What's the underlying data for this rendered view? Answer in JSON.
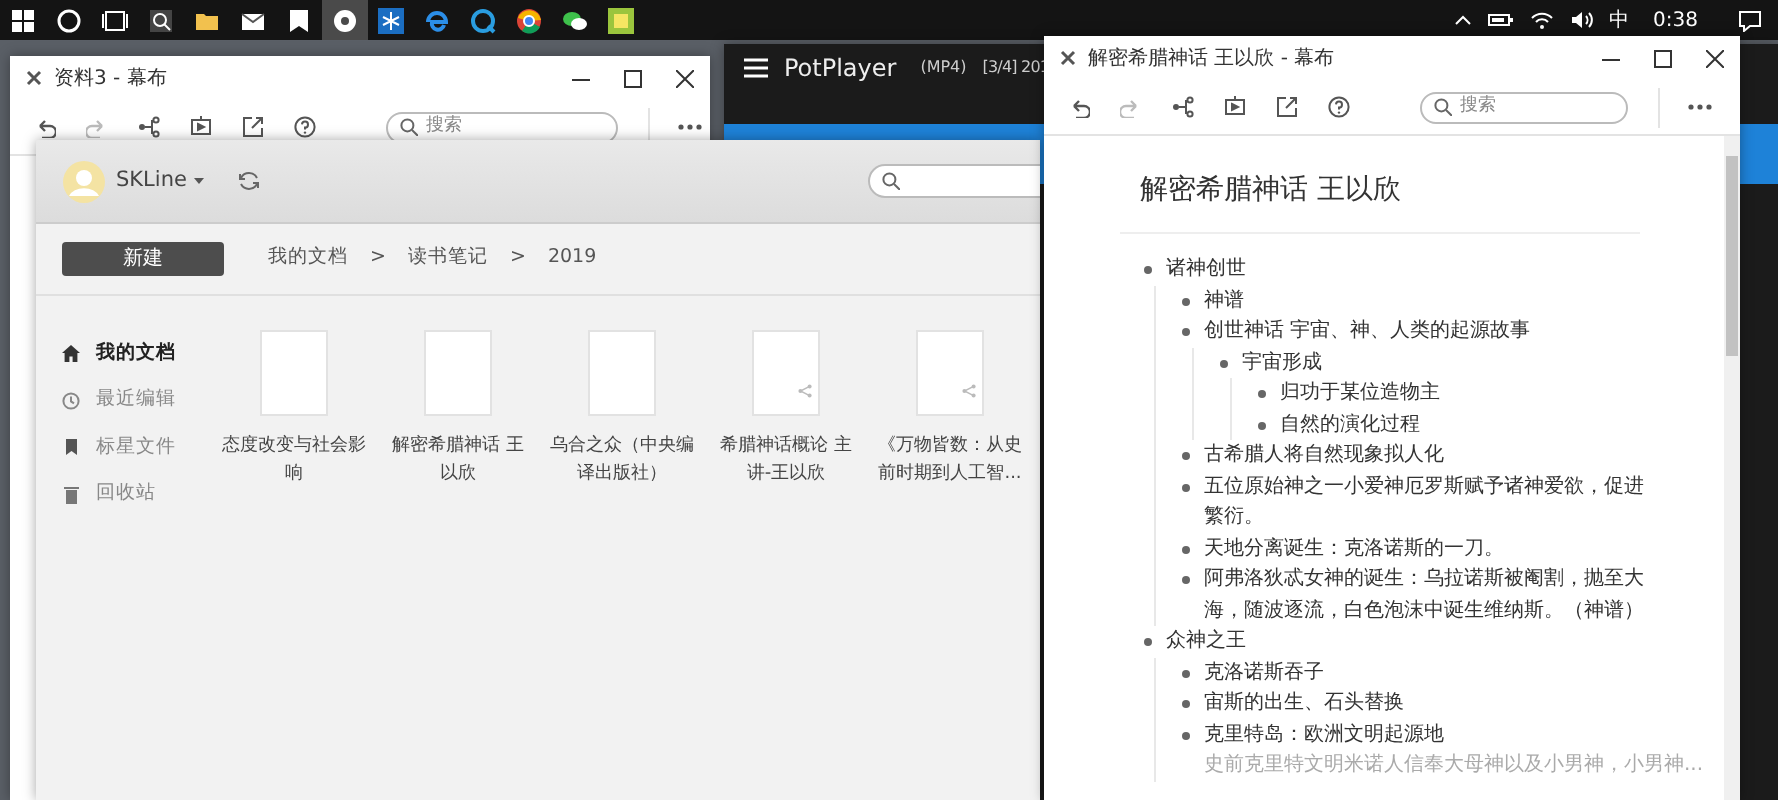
{
  "taskbar": {
    "apps": [
      {
        "selected": false
      },
      {
        "selected": false
      },
      {
        "selected": false
      },
      {
        "selected": false
      },
      {
        "selected": false
      },
      {
        "selected": false
      },
      {
        "selected": true
      },
      {
        "selected": false
      },
      {
        "selected": false
      },
      {
        "selected": false
      },
      {
        "selected": false
      },
      {
        "selected": false
      },
      {
        "selected": false
      }
    ],
    "ime": "中",
    "time": "0:38"
  },
  "player_window": {
    "title": "PotPlayer",
    "format": "(MP4)",
    "track": "[3/4] 201"
  },
  "back_note_window": {
    "title": "资料3 - 幕布",
    "search": {
      "placeholder": "搜索"
    }
  },
  "library_window": {
    "user": "SKLine",
    "new_button": "新建",
    "breadcrumb": [
      "我的文档",
      ">",
      "读书笔记",
      ">",
      "2019"
    ],
    "sidebar": [
      {
        "label": "我的文档",
        "selected": true
      },
      {
        "label": "最近编辑",
        "selected": false
      },
      {
        "label": "标星文件",
        "selected": false
      },
      {
        "label": "回收站",
        "selected": false
      }
    ],
    "documents": [
      {
        "title": "态度改变与社会影响",
        "shared": false
      },
      {
        "title": "解密希腊神话 王以欣",
        "shared": false
      },
      {
        "title": "乌合之众（中央编译出版社）",
        "shared": false
      },
      {
        "title": "希腊神话概论 主讲-王以欣",
        "shared": true
      },
      {
        "title": "《万物皆数：从史前时期到人工智...",
        "shared": true
      }
    ]
  },
  "note_window": {
    "title": "解密希腊神话 王以欣 - 幕布",
    "search": {
      "placeholder": "搜索"
    },
    "doc_title": "解密希腊神话 王以欣",
    "outline": [
      {
        "text": "诸神创世",
        "children": [
          {
            "text": "神谱"
          },
          {
            "text": "创世神话 宇宙、神、人类的起源故事",
            "children": [
              {
                "text": "宇宙形成",
                "children": [
                  {
                    "text": "归功于某位造物主"
                  },
                  {
                    "text": "自然的演化过程"
                  }
                ]
              }
            ]
          },
          {
            "text": "古希腊人将自然现象拟人化"
          },
          {
            "text": "五位原始神之一小爱神厄罗斯赋予诸神爱欲，促进繁衍。"
          },
          {
            "text": "天地分离诞生：克洛诺斯的一刀。"
          },
          {
            "text": "阿弗洛狄忒女神的诞生：乌拉诺斯被阉割，抛至大海，随波逐流，白色泡沫中诞生维纳斯。（神谱）"
          }
        ]
      },
      {
        "text": "众神之王",
        "children": [
          {
            "text": "克洛诺斯吞子"
          },
          {
            "text": "宙斯的出生、石头替换"
          },
          {
            "text": "克里特岛：欧洲文明起源地",
            "note": "史前克里特文明米诺人信奉大母神以及小男神，小男神..."
          }
        ]
      }
    ]
  }
}
